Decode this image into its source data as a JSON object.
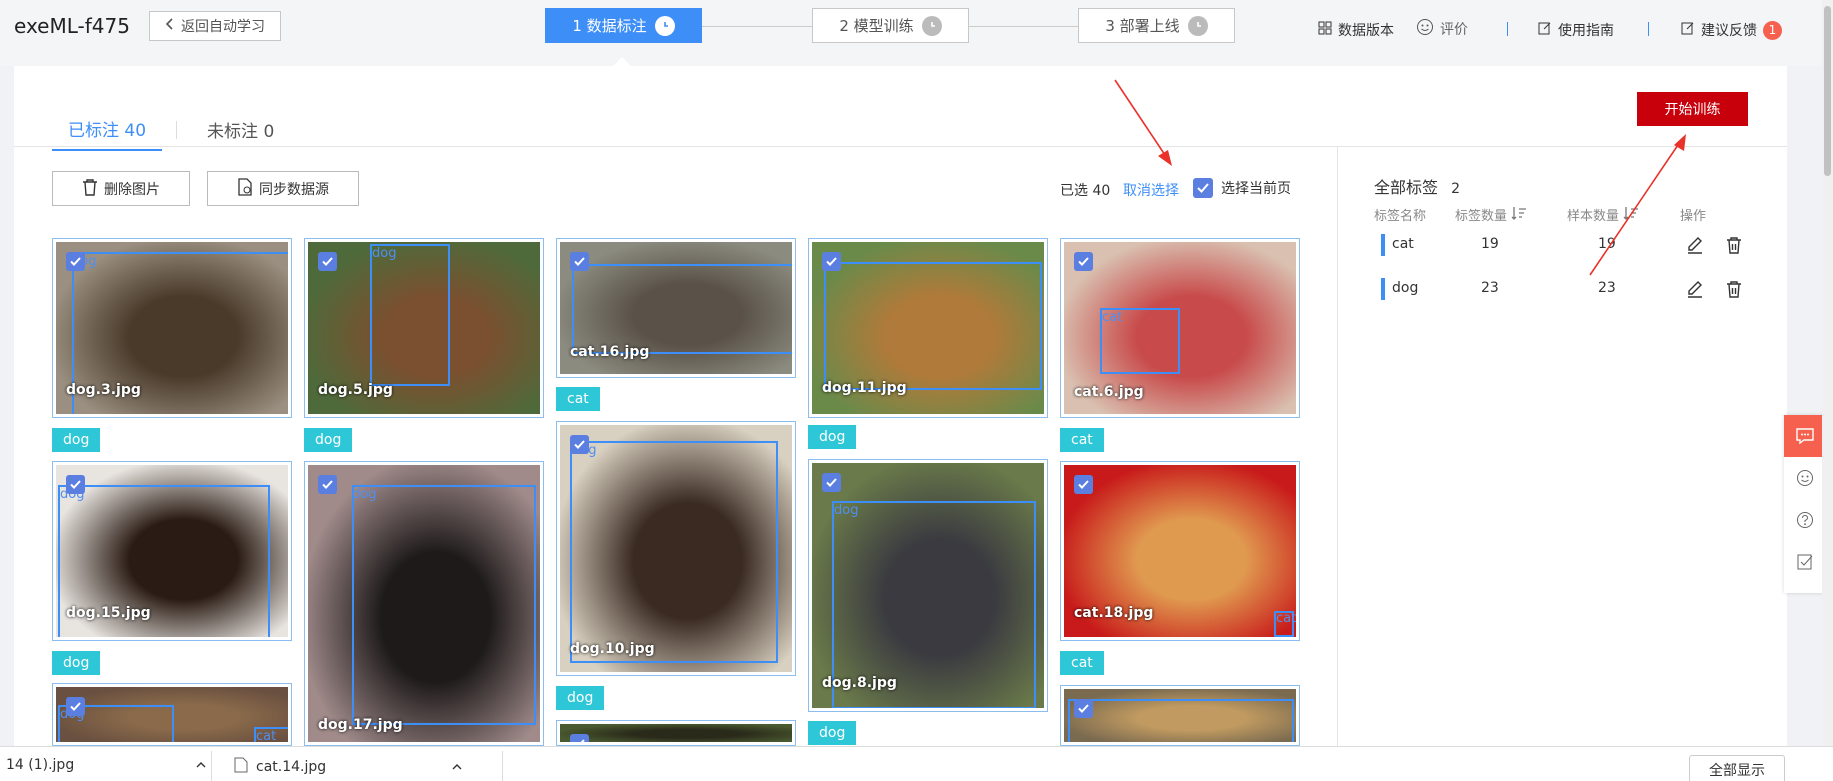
{
  "app": {
    "title": "exeML-f475",
    "back_label": "返回自动学习"
  },
  "steps": [
    {
      "label": "1 数据标注",
      "active": true
    },
    {
      "label": "2 模型训练",
      "active": false
    },
    {
      "label": "3 部署上线",
      "active": false
    }
  ],
  "topnav": {
    "data_version": "数据版本",
    "rate": "评价",
    "guide": "使用指南",
    "feedback": "建议反馈",
    "feedback_count": "1"
  },
  "tabs": {
    "labeled": "已标注 40",
    "unlabeled": "未标注 0"
  },
  "toolbar": {
    "delete": "删除图片",
    "sync": "同步数据源",
    "selected": "已选 40",
    "cancel": "取消选择",
    "select_page": "选择当前页"
  },
  "train_button": "开始训练",
  "images": [
    {
      "name": "dog.3.jpg",
      "tag": "dog",
      "bbox_label": "dog",
      "colors": [
        "#9a8f80",
        "#4a3a2a"
      ]
    },
    {
      "name": "dog.5.jpg",
      "tag": "dog",
      "bbox_label": "dog",
      "colors": [
        "#4f6a3a",
        "#7a5030"
      ]
    },
    {
      "name": "cat.16.jpg",
      "tag": "cat",
      "bbox_label": "",
      "colors": [
        "#8b8b80",
        "#5a5248"
      ]
    },
    {
      "name": "dog.11.jpg",
      "tag": "dog",
      "bbox_label": "",
      "colors": [
        "#6a8a4a",
        "#b07a3a"
      ]
    },
    {
      "name": "cat.6.jpg",
      "tag": "cat",
      "bbox_label": "cat",
      "colors": [
        "#d9c0b0",
        "#c84a4a"
      ]
    },
    {
      "name": "dog.15.jpg",
      "tag": "dog",
      "bbox_label": "dog",
      "colors": [
        "#e8e4e0",
        "#2a1c14"
      ]
    },
    {
      "name": "dog.17.jpg",
      "tag": "",
      "bbox_label": "dog",
      "colors": [
        "#a08a8a",
        "#1e1a1a"
      ]
    },
    {
      "name": "dog.10.jpg",
      "tag": "dog",
      "bbox_label": "dog",
      "colors": [
        "#d8d0c0",
        "#3a2a22"
      ]
    },
    {
      "name": "dog.8.jpg",
      "tag": "dog",
      "bbox_label": "dog",
      "colors": [
        "#6a7a4a",
        "#3a3a40"
      ]
    },
    {
      "name": "cat.18.jpg",
      "tag": "cat",
      "bbox_label": "cat",
      "colors": [
        "#c81a1a",
        "#e09a50"
      ]
    },
    {
      "name": "",
      "tag": "",
      "bbox_label": "dog",
      "colors": [
        "#6a5040",
        "#8a6a4a"
      ],
      "bbox_label2": "cat"
    },
    {
      "name": "",
      "tag": "",
      "bbox_label": "",
      "colors": [
        "#4a5a30",
        "#2a2a1a"
      ]
    },
    {
      "name": "",
      "tag": "",
      "bbox_label": "",
      "colors": [
        "#7a6a50",
        "#c09a60"
      ]
    }
  ],
  "labels": {
    "title": "全部标签",
    "count": "2",
    "headers": {
      "name": "标签名称",
      "tag_count": "标签数量",
      "sample_count": "样本数量",
      "ops": "操作"
    },
    "rows": [
      {
        "name": "cat",
        "tag_count": "19",
        "sample_count": "19"
      },
      {
        "name": "dog",
        "tag_count": "23",
        "sample_count": "23"
      }
    ]
  },
  "downloads": [
    {
      "name": "14 (1).jpg"
    },
    {
      "name": "cat.14.jpg"
    }
  ],
  "download_all": "全部显示",
  "colors": {
    "accent": "#3e8ef7",
    "train": "#c7000b",
    "tag": "#2ec7d7",
    "annotation_arrow": "#e8322a"
  }
}
